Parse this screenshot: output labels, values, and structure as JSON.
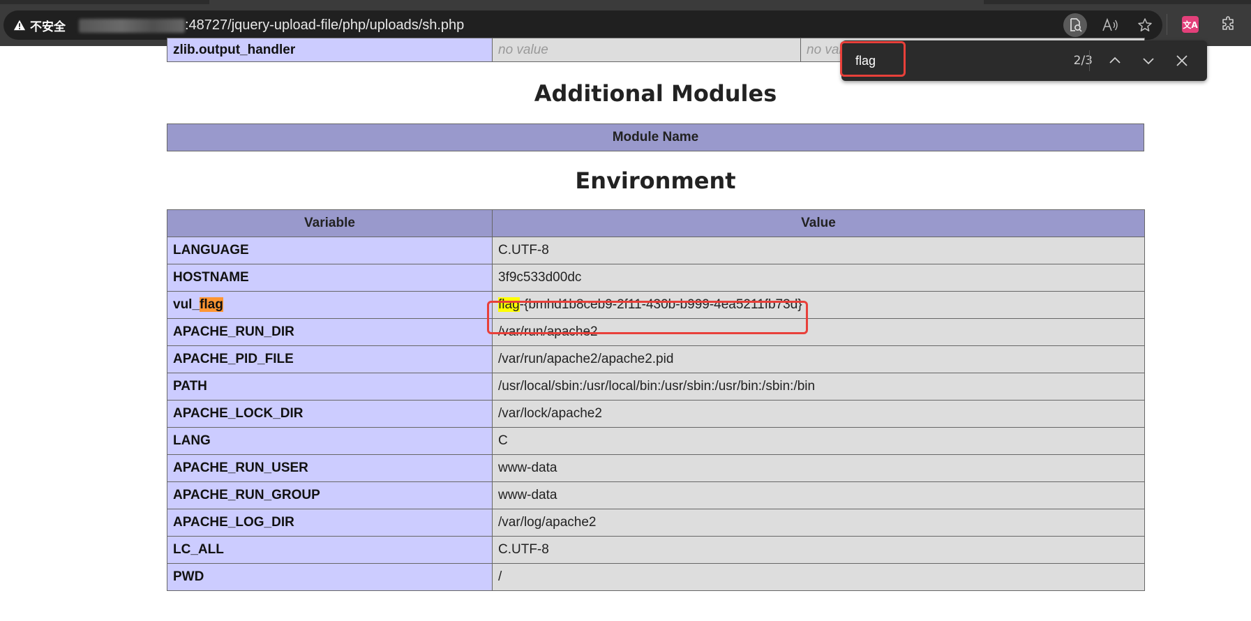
{
  "browser": {
    "security_label": "不安全",
    "url": ":48727/jquery-upload-file/php/uploads/sh.php",
    "translate_badge": "文A"
  },
  "find": {
    "query": "flag",
    "count": "2/3"
  },
  "prev_table": {
    "row": {
      "name": "zlib.output_handler",
      "local": "no value",
      "master": "no value"
    }
  },
  "modules": {
    "title": "Additional Modules",
    "header": "Module Name"
  },
  "environment": {
    "title": "Environment",
    "headers": {
      "variable": "Variable",
      "value": "Value"
    },
    "rows": [
      {
        "name": "LANGUAGE",
        "value": "C.UTF-8"
      },
      {
        "name": "HOSTNAME",
        "value": "3f9c533d00dc"
      },
      {
        "name_prefix": "vul_",
        "name_match": "flag",
        "value_match": "flag",
        "value_rest": "-{bmhd1b8ceb9-2f11-430b-b999-4ea5211fb73d}"
      },
      {
        "name": "APACHE_RUN_DIR",
        "value": "/var/run/apache2"
      },
      {
        "name": "APACHE_PID_FILE",
        "value": "/var/run/apache2/apache2.pid"
      },
      {
        "name": "PATH",
        "value": "/usr/local/sbin:/usr/local/bin:/usr/sbin:/usr/bin:/sbin:/bin"
      },
      {
        "name": "APACHE_LOCK_DIR",
        "value": "/var/lock/apache2"
      },
      {
        "name": "LANG",
        "value": "C"
      },
      {
        "name": "APACHE_RUN_USER",
        "value": "www-data"
      },
      {
        "name": "APACHE_RUN_GROUP",
        "value": "www-data"
      },
      {
        "name": "APACHE_LOG_DIR",
        "value": "/var/log/apache2"
      },
      {
        "name": "LC_ALL",
        "value": "C.UTF-8"
      },
      {
        "name": "PWD",
        "value": "/"
      }
    ]
  },
  "colors": {
    "highlight_active": "#ff9632",
    "highlight_match": "#ffff00",
    "annotation_red": "#e8403a"
  }
}
